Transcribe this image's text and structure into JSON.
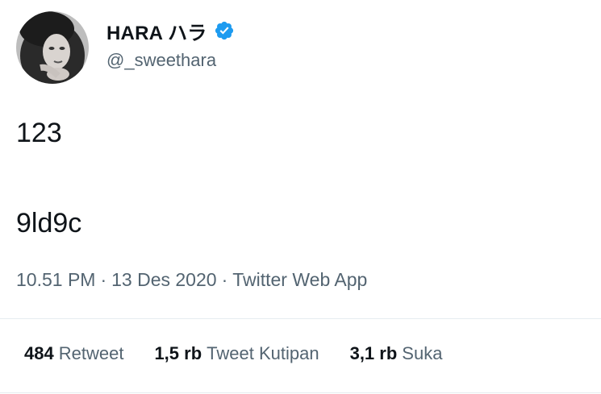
{
  "tweet": {
    "author": {
      "display_name": "HARA ハラ",
      "handle": "@_sweethara",
      "verified": true,
      "avatar_icon": "avatar-photo"
    },
    "text_lines": [
      "123",
      "9ld9c"
    ],
    "meta": {
      "time": "10.51 PM",
      "separator": "·",
      "date": "13 Des 2020",
      "source": "Twitter Web App"
    },
    "stats": [
      {
        "count": "484",
        "label": "Retweet"
      },
      {
        "count": "1,5 rb",
        "label": "Tweet Kutipan"
      },
      {
        "count": "3,1 rb",
        "label": "Suka"
      }
    ]
  },
  "colors": {
    "text": "#0f1419",
    "secondary": "#536471",
    "verified": "#1d9bf0",
    "divider": "#e6ecf0"
  }
}
